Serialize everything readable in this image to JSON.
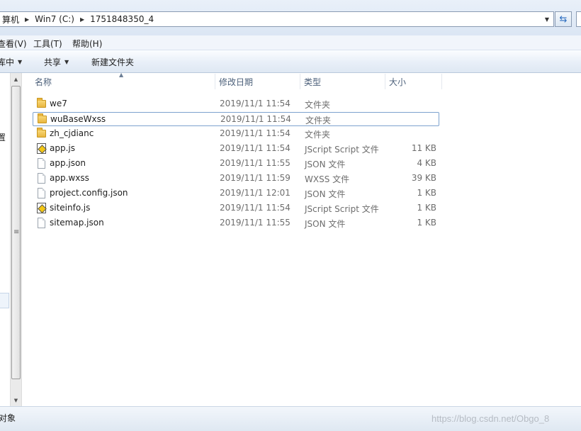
{
  "address_bar": {
    "crumbs": [
      "算机",
      "Win7 (C:)",
      "1751848350_4"
    ]
  },
  "menu": {
    "items": [
      "查看(V)",
      "工具(T)",
      "帮助(H)"
    ]
  },
  "toolbar": {
    "include_label": "库中",
    "share_label": "共享",
    "new_folder_label": "新建文件夹"
  },
  "nav": {
    "partial_label": "置"
  },
  "columns": {
    "name": "名称",
    "date": "修改日期",
    "type": "类型",
    "size": "大小"
  },
  "files": [
    {
      "name": "we7",
      "date": "2019/11/1 11:54",
      "type": "文件夹",
      "size": "",
      "icon": "folder-icon"
    },
    {
      "name": "wuBaseWxss",
      "date": "2019/11/1 11:54",
      "type": "文件夹",
      "size": "",
      "icon": "folder-icon",
      "selected": true
    },
    {
      "name": "zh_cjdianc",
      "date": "2019/11/1 11:54",
      "type": "文件夹",
      "size": "",
      "icon": "folder-icon"
    },
    {
      "name": "app.js",
      "date": "2019/11/1 11:54",
      "type": "JScript Script 文件",
      "size": "11 KB",
      "icon": "jscript-icon"
    },
    {
      "name": "app.json",
      "date": "2019/11/1 11:55",
      "type": "JSON 文件",
      "size": "4 KB",
      "icon": "document-icon"
    },
    {
      "name": "app.wxss",
      "date": "2019/11/1 11:59",
      "type": "WXSS 文件",
      "size": "39 KB",
      "icon": "document-icon"
    },
    {
      "name": "project.config.json",
      "date": "2019/11/1 12:01",
      "type": "JSON 文件",
      "size": "1 KB",
      "icon": "document-icon"
    },
    {
      "name": "siteinfo.js",
      "date": "2019/11/1 11:54",
      "type": "JScript Script 文件",
      "size": "1 KB",
      "icon": "jscript-icon"
    },
    {
      "name": "sitemap.json",
      "date": "2019/11/1 11:55",
      "type": "JSON 文件",
      "size": "1 KB",
      "icon": "document-icon"
    }
  ],
  "status": {
    "text": "对象"
  },
  "watermark": "https://blog.csdn.net/Obgo_8"
}
